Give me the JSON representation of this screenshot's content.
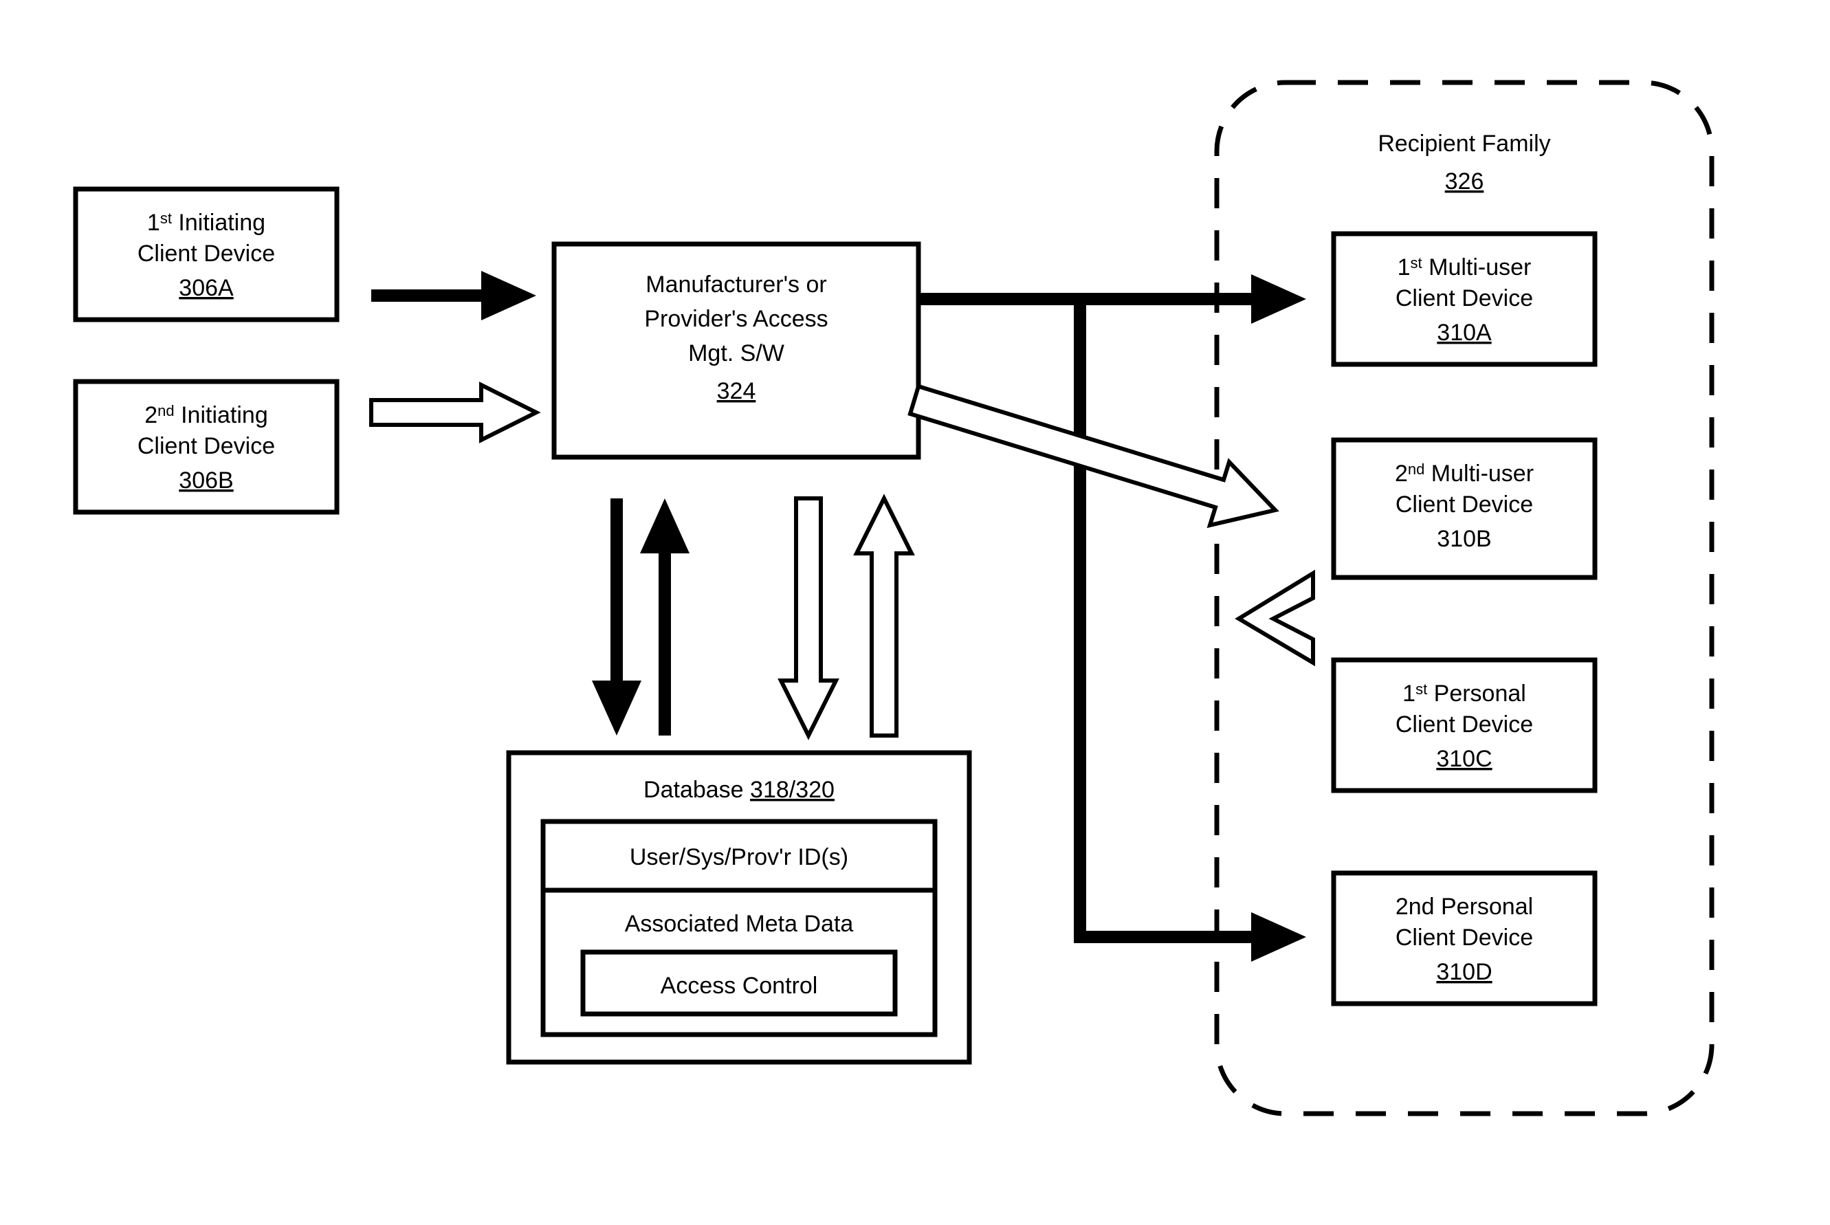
{
  "boxes": {
    "init1": {
      "line1_pre": "1",
      "line1_sup": "st",
      "line1_post": " Initiating",
      "line2": "Client Device",
      "ref": "306A"
    },
    "init2": {
      "line1_pre": "2",
      "line1_sup": "nd",
      "line1_post": " Initiating",
      "line2": "Client Device",
      "ref": "306B"
    },
    "mgr": {
      "line1": "Manufacturer's or",
      "line2": "Provider's Access",
      "line3": "Mgt. S/W",
      "ref": "324"
    },
    "db": {
      "title_pre": "Database ",
      "title_ref": "318/320",
      "row1": "User/Sys/Prov'r ID(s)",
      "row2": "Associated Meta Data",
      "inner": "Access Control"
    },
    "family": {
      "title": "Recipient Family",
      "ref": "326"
    },
    "mu1": {
      "line1_pre": "1",
      "line1_sup": "st",
      "line1_post": " Multi-user",
      "line2": "Client Device",
      "ref": "310A"
    },
    "mu2": {
      "line1_pre": "2",
      "line1_sup": "nd",
      "line1_post": " Multi-user",
      "line2": "Client Device",
      "ref_plain": "310B"
    },
    "p1": {
      "line1_pre": "1",
      "line1_sup": "st",
      "line1_post": " Personal",
      "line2": "Client Device",
      "ref": "310C"
    },
    "p2": {
      "line1": "2nd Personal",
      "line2": "Client Device",
      "ref": "310D"
    }
  }
}
